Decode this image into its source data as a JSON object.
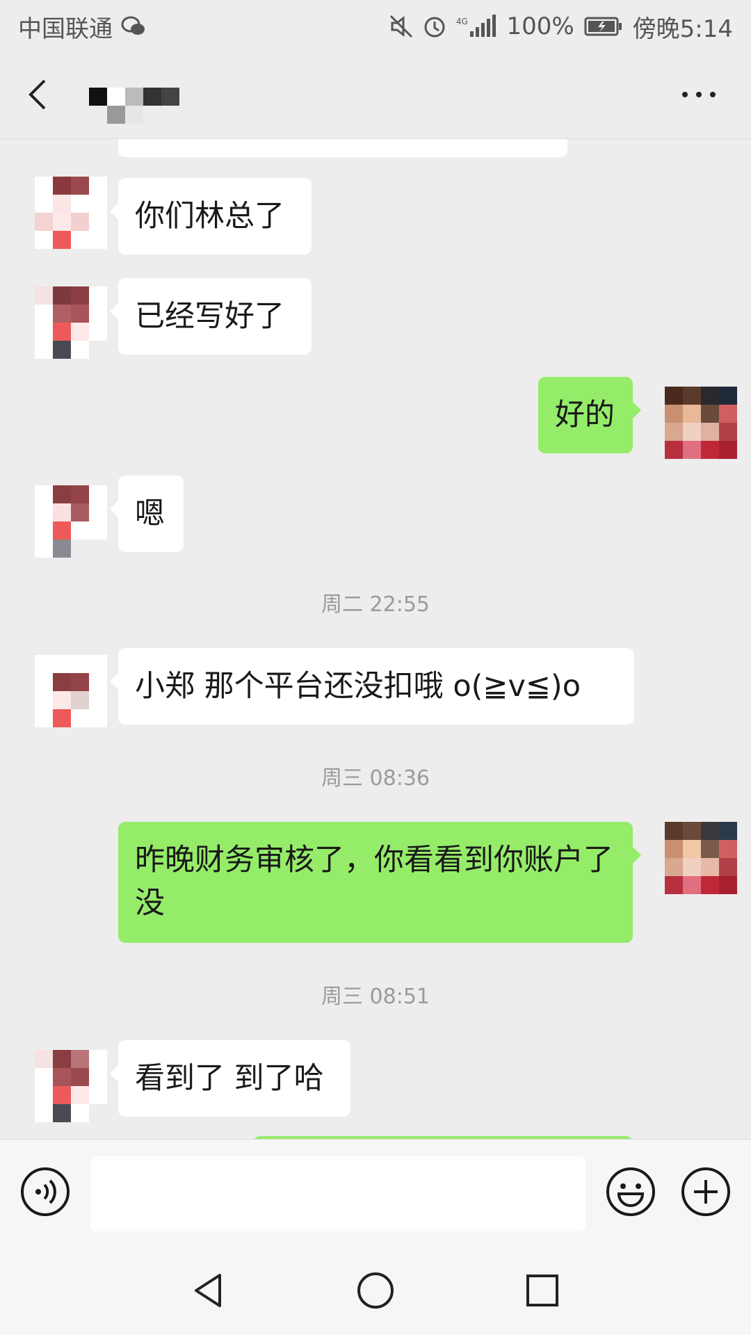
{
  "status_bar": {
    "carrier": "中国联通",
    "network": "4G",
    "battery": "100%",
    "time": "傍晚5:14"
  },
  "nav": {
    "back_icon": "chevron-left-icon",
    "more_icon": "more-dots-icon"
  },
  "messages": [
    {
      "side": "in",
      "text": "你们林总了"
    },
    {
      "side": "in",
      "text": "已经写好了"
    },
    {
      "side": "out",
      "text": "好的"
    },
    {
      "side": "in",
      "text": "嗯"
    },
    {
      "type": "time",
      "text": "周二 22:55"
    },
    {
      "side": "in",
      "text": "小郑 那个平台还没扣哦 o(≧v≦)o"
    },
    {
      "type": "time",
      "text": "周三 08:36"
    },
    {
      "side": "out",
      "text": "昨晚财务审核了，你看看到你账户了没"
    },
    {
      "type": "time",
      "text": "周三 08:51"
    },
    {
      "side": "in",
      "text": "看到了 到了哈"
    }
  ],
  "input_bar": {
    "placeholder": "",
    "icons": [
      "voice-icon",
      "emoji-icon",
      "plus-icon"
    ]
  },
  "colors": {
    "background": "#ededed",
    "incoming_bubble": "#ffffff",
    "outgoing_bubble": "#95ec69"
  }
}
